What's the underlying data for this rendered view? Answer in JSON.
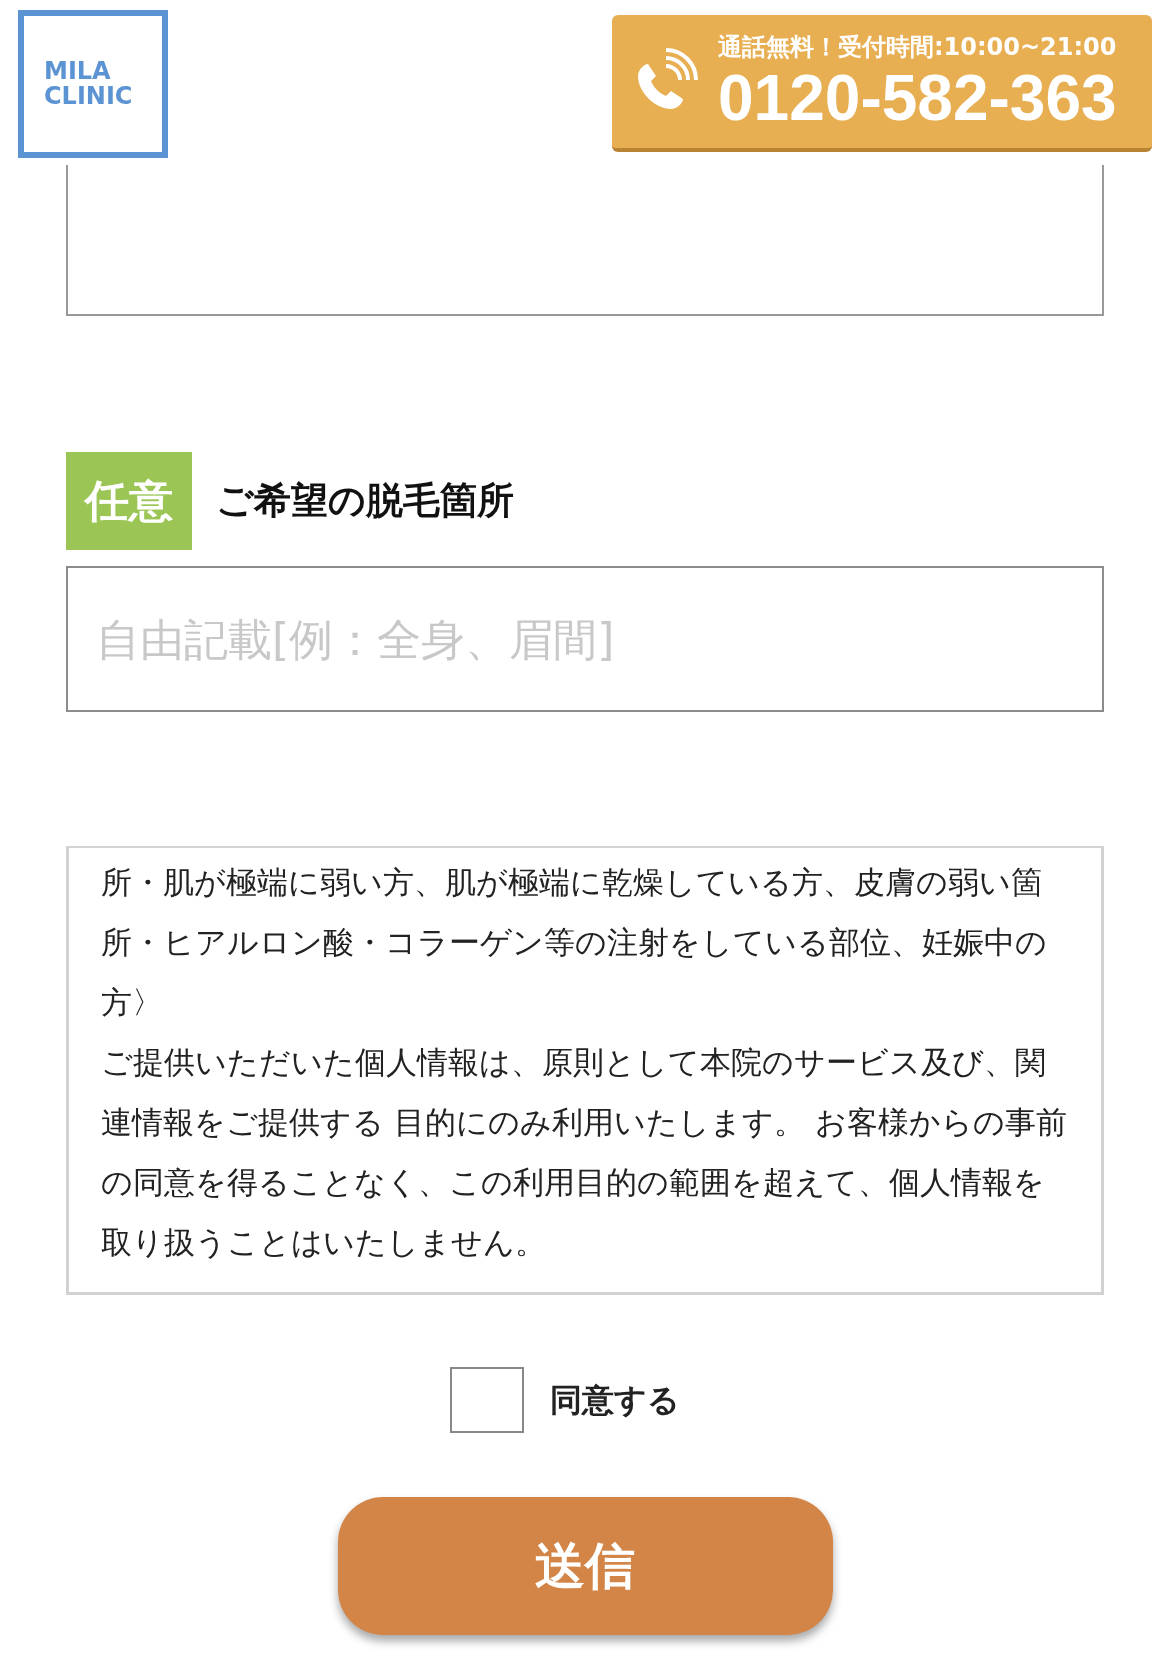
{
  "header": {
    "logo": {
      "lines": [
        "MILA",
        "CLINIC"
      ]
    },
    "phone_button": {
      "note": "通話無料！受付時間:10:00~21:00",
      "number": "0120-582-363"
    }
  },
  "previous_field": {
    "kind": "textarea"
  },
  "fields": [
    {
      "badge": "任意",
      "label": "ご希望の脱毛箇所",
      "placeholder": "自由記載[例：全身、眉間]"
    }
  ],
  "terms": {
    "paragraphs": [
      "所・肌が極端に弱い方、肌が極端に乾燥している方、皮膚の弱い箇所・ヒアルロン酸・コラーゲン等の注射をしている部位、妊娠中の方〉",
      "ご提供いただいた個人情報は、原則として本院のサービス及び、関連情報をご提供する 目的にのみ利用いたします。 お客様からの事前の同意を得ることなく、この利用目的の範囲を超えて、個人情報を取り扱うことはいたしません。"
    ]
  },
  "agree": {
    "label": "同意する",
    "checked": false
  },
  "submit": {
    "label": "送信"
  }
}
